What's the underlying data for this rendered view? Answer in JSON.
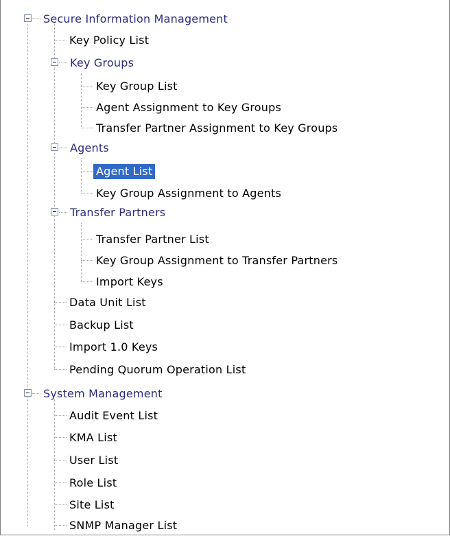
{
  "tree": {
    "secure": {
      "label": "Secure Information Management",
      "key_policy_list": "Key Policy List",
      "key_groups": {
        "label": "Key Groups",
        "items": [
          "Key Group List",
          "Agent Assignment to Key Groups",
          "Transfer Partner Assignment to Key Groups"
        ]
      },
      "agents": {
        "label": "Agents",
        "items": [
          "Agent List",
          "Key Group Assignment to Agents"
        ]
      },
      "transfer_partners": {
        "label": "Transfer Partners",
        "items": [
          "Transfer Partner List",
          "Key Group Assignment to Transfer Partners",
          "Import Keys"
        ]
      },
      "items": [
        "Data Unit List",
        "Backup List",
        "Import 1.0 Keys",
        "Pending Quorum Operation List"
      ]
    },
    "system": {
      "label": "System Management",
      "items": [
        "Audit Event List",
        "KMA List",
        "User List",
        "Role List",
        "Site List",
        "SNMP Manager List"
      ]
    }
  },
  "colors": {
    "selection": "#3169c6",
    "group_text": "#2b2b7d"
  }
}
